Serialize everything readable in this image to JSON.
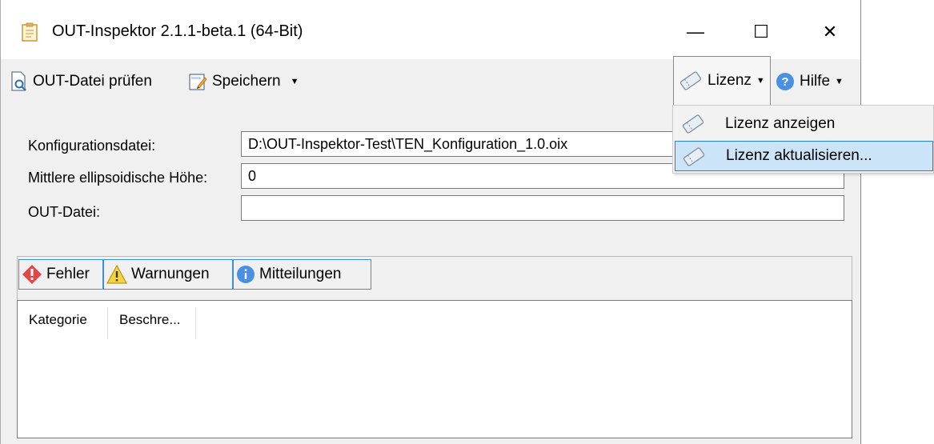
{
  "window": {
    "title": "OUT-Inspektor 2.1.1-beta.1 (64-Bit)",
    "app_icon": "clipboard-icon",
    "minimize_glyph": "—",
    "maximize_glyph": "☐",
    "close_glyph": "✕"
  },
  "toolbar": {
    "check_label": "OUT-Datei prüfen",
    "check_icon": "document-magnifier-icon",
    "save_label": "Speichern",
    "save_icon": "save-document-icon",
    "license_label": "Lizenz",
    "license_icon": "license-ticket-icon",
    "help_label": "Hilfe",
    "help_icon": "question-icon"
  },
  "form": {
    "config_label": "Konfigurationsdatei:",
    "config_value": "D:\\OUT-Inspektor-Test\\TEN_Konfiguration_1.0.oix",
    "height_label": "Mittlere ellipsoidische Höhe:",
    "height_value": "0",
    "out_label": "OUT-Datei:",
    "out_value": ""
  },
  "tabs": {
    "errors_label": "Fehler",
    "warnings_label": "Warnungen",
    "messages_label": "Mitteilungen"
  },
  "list": {
    "columns": [
      "Kategorie",
      "Beschre..."
    ]
  },
  "license_menu": {
    "items": [
      {
        "label": "Lizenz anzeigen",
        "highlighted": false
      },
      {
        "label": "Lizenz aktualisieren...",
        "highlighted": true
      }
    ]
  },
  "colors": {
    "accent": "#2a7fd3",
    "highlight": "#cce4f7",
    "error": "#e04848",
    "warning": "#f5d33a",
    "info": "#4a90e2"
  }
}
